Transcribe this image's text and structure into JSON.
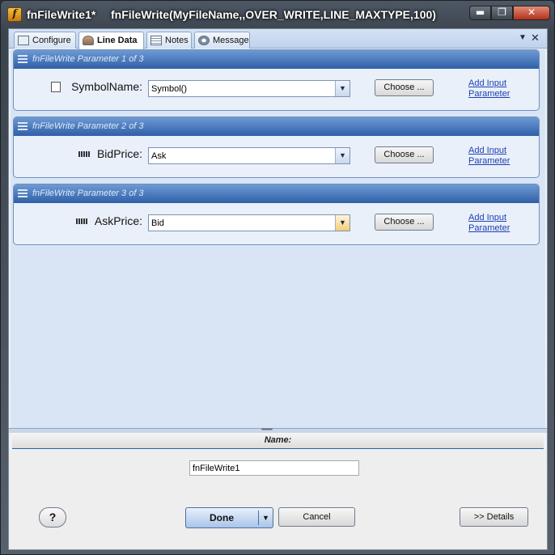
{
  "window": {
    "title": "fnFileWrite1*",
    "expression": "fnFileWrite(MyFileName,,OVER_WRITE,LINE_MAXTYPE,100)",
    "app_icon_letter": "f",
    "controls": {
      "minimize": "▬",
      "maximize": "❐",
      "close": "✕"
    }
  },
  "tabs": [
    {
      "label": "Configure",
      "icon": "configure-icon",
      "active": false
    },
    {
      "label": "Line Data",
      "icon": "line-data-icon",
      "active": true
    },
    {
      "label": "Notes",
      "icon": "notes-icon",
      "active": false
    },
    {
      "label": "Message",
      "icon": "message-icon",
      "active": false
    }
  ],
  "tab_controls": {
    "dropdown": "▼",
    "close": "✕"
  },
  "parameters": [
    {
      "header": "fnFileWrite Parameter 1 of 3",
      "label": "SymbolName:",
      "icon": "string-type-icon",
      "value": "Symbol()",
      "choose": "Choose ...",
      "add_line1": "Add Input",
      "add_line2": "Parameter"
    },
    {
      "header": "fnFileWrite Parameter 2 of 3",
      "label": "BidPrice:",
      "icon": "numeric-type-icon",
      "value": "Ask",
      "choose": "Choose ...",
      "add_line1": "Add Input",
      "add_line2": "Parameter"
    },
    {
      "header": "fnFileWrite Parameter 3 of 3",
      "label": "AskPrice:",
      "icon": "numeric-type-icon",
      "value": "Bid",
      "choose": "Choose ...",
      "add_line1": "Add Input",
      "add_line2": "Parameter"
    }
  ],
  "name_section": {
    "header": "Name:",
    "value": "fnFileWrite1"
  },
  "footer": {
    "help": "?",
    "done": "Done",
    "cancel": "Cancel",
    "details": ">> Details"
  },
  "colors": {
    "group_header": "#2f5fa8",
    "content_bg": "#d9e5f5",
    "link": "#1f3fb3"
  }
}
